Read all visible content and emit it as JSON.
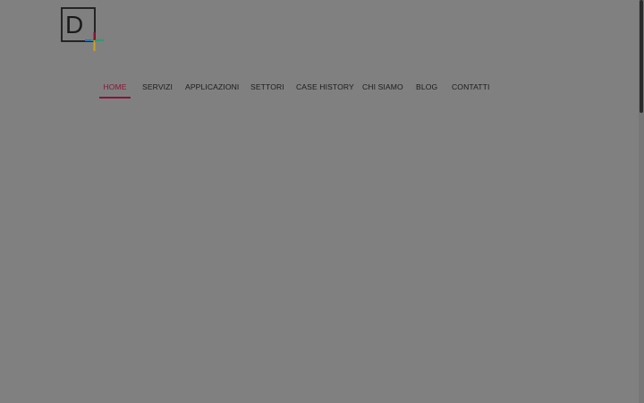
{
  "logo": {
    "letter": "D",
    "icon": "d-plus-logo",
    "plus_colors": [
      "#8a1538",
      "#2e9b6f",
      "#2f73b8",
      "#c9a227"
    ]
  },
  "nav": {
    "items": [
      {
        "label": "HOME",
        "active": true
      },
      {
        "label": "SERVIZI",
        "active": false
      },
      {
        "label": "APPLICAZIONI",
        "active": false
      },
      {
        "label": "SETTORI",
        "active": false
      },
      {
        "label": "CASE HISTORY",
        "active": false
      },
      {
        "label": "CHI SIAMO",
        "active": false
      },
      {
        "label": "BLOG",
        "active": false
      },
      {
        "label": "CONTATTI",
        "active": false
      }
    ],
    "active_color": "#8a1538"
  },
  "colors": {
    "overlay": "#808080",
    "text": "#1c1c1c"
  }
}
